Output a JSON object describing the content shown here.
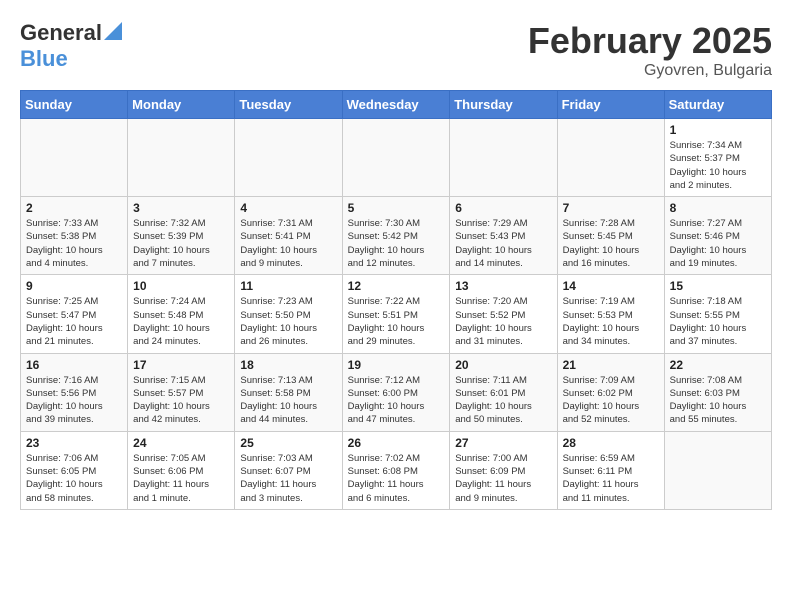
{
  "header": {
    "logo_line1": "General",
    "logo_line2": "Blue",
    "month": "February 2025",
    "location": "Gyovren, Bulgaria"
  },
  "weekdays": [
    "Sunday",
    "Monday",
    "Tuesday",
    "Wednesday",
    "Thursday",
    "Friday",
    "Saturday"
  ],
  "weeks": [
    [
      {
        "day": "",
        "info": ""
      },
      {
        "day": "",
        "info": ""
      },
      {
        "day": "",
        "info": ""
      },
      {
        "day": "",
        "info": ""
      },
      {
        "day": "",
        "info": ""
      },
      {
        "day": "",
        "info": ""
      },
      {
        "day": "1",
        "info": "Sunrise: 7:34 AM\nSunset: 5:37 PM\nDaylight: 10 hours\nand 2 minutes."
      }
    ],
    [
      {
        "day": "2",
        "info": "Sunrise: 7:33 AM\nSunset: 5:38 PM\nDaylight: 10 hours\nand 4 minutes."
      },
      {
        "day": "3",
        "info": "Sunrise: 7:32 AM\nSunset: 5:39 PM\nDaylight: 10 hours\nand 7 minutes."
      },
      {
        "day": "4",
        "info": "Sunrise: 7:31 AM\nSunset: 5:41 PM\nDaylight: 10 hours\nand 9 minutes."
      },
      {
        "day": "5",
        "info": "Sunrise: 7:30 AM\nSunset: 5:42 PM\nDaylight: 10 hours\nand 12 minutes."
      },
      {
        "day": "6",
        "info": "Sunrise: 7:29 AM\nSunset: 5:43 PM\nDaylight: 10 hours\nand 14 minutes."
      },
      {
        "day": "7",
        "info": "Sunrise: 7:28 AM\nSunset: 5:45 PM\nDaylight: 10 hours\nand 16 minutes."
      },
      {
        "day": "8",
        "info": "Sunrise: 7:27 AM\nSunset: 5:46 PM\nDaylight: 10 hours\nand 19 minutes."
      }
    ],
    [
      {
        "day": "9",
        "info": "Sunrise: 7:25 AM\nSunset: 5:47 PM\nDaylight: 10 hours\nand 21 minutes."
      },
      {
        "day": "10",
        "info": "Sunrise: 7:24 AM\nSunset: 5:48 PM\nDaylight: 10 hours\nand 24 minutes."
      },
      {
        "day": "11",
        "info": "Sunrise: 7:23 AM\nSunset: 5:50 PM\nDaylight: 10 hours\nand 26 minutes."
      },
      {
        "day": "12",
        "info": "Sunrise: 7:22 AM\nSunset: 5:51 PM\nDaylight: 10 hours\nand 29 minutes."
      },
      {
        "day": "13",
        "info": "Sunrise: 7:20 AM\nSunset: 5:52 PM\nDaylight: 10 hours\nand 31 minutes."
      },
      {
        "day": "14",
        "info": "Sunrise: 7:19 AM\nSunset: 5:53 PM\nDaylight: 10 hours\nand 34 minutes."
      },
      {
        "day": "15",
        "info": "Sunrise: 7:18 AM\nSunset: 5:55 PM\nDaylight: 10 hours\nand 37 minutes."
      }
    ],
    [
      {
        "day": "16",
        "info": "Sunrise: 7:16 AM\nSunset: 5:56 PM\nDaylight: 10 hours\nand 39 minutes."
      },
      {
        "day": "17",
        "info": "Sunrise: 7:15 AM\nSunset: 5:57 PM\nDaylight: 10 hours\nand 42 minutes."
      },
      {
        "day": "18",
        "info": "Sunrise: 7:13 AM\nSunset: 5:58 PM\nDaylight: 10 hours\nand 44 minutes."
      },
      {
        "day": "19",
        "info": "Sunrise: 7:12 AM\nSunset: 6:00 PM\nDaylight: 10 hours\nand 47 minutes."
      },
      {
        "day": "20",
        "info": "Sunrise: 7:11 AM\nSunset: 6:01 PM\nDaylight: 10 hours\nand 50 minutes."
      },
      {
        "day": "21",
        "info": "Sunrise: 7:09 AM\nSunset: 6:02 PM\nDaylight: 10 hours\nand 52 minutes."
      },
      {
        "day": "22",
        "info": "Sunrise: 7:08 AM\nSunset: 6:03 PM\nDaylight: 10 hours\nand 55 minutes."
      }
    ],
    [
      {
        "day": "23",
        "info": "Sunrise: 7:06 AM\nSunset: 6:05 PM\nDaylight: 10 hours\nand 58 minutes."
      },
      {
        "day": "24",
        "info": "Sunrise: 7:05 AM\nSunset: 6:06 PM\nDaylight: 11 hours\nand 1 minute."
      },
      {
        "day": "25",
        "info": "Sunrise: 7:03 AM\nSunset: 6:07 PM\nDaylight: 11 hours\nand 3 minutes."
      },
      {
        "day": "26",
        "info": "Sunrise: 7:02 AM\nSunset: 6:08 PM\nDaylight: 11 hours\nand 6 minutes."
      },
      {
        "day": "27",
        "info": "Sunrise: 7:00 AM\nSunset: 6:09 PM\nDaylight: 11 hours\nand 9 minutes."
      },
      {
        "day": "28",
        "info": "Sunrise: 6:59 AM\nSunset: 6:11 PM\nDaylight: 11 hours\nand 11 minutes."
      },
      {
        "day": "",
        "info": ""
      }
    ]
  ]
}
